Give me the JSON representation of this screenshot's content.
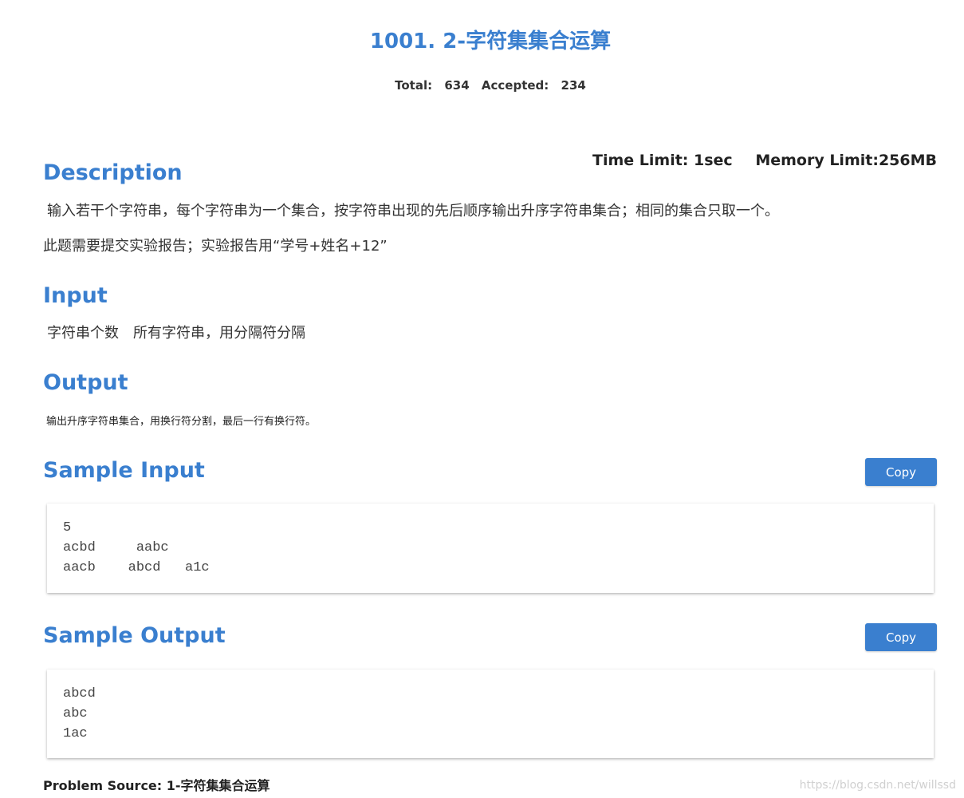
{
  "problem": {
    "title": "1001. 2-字符集集合运算",
    "total_label": "Total:",
    "total_value": "634",
    "accepted_label": "Accepted:",
    "accepted_value": "234",
    "time_limit": "Time Limit: 1sec",
    "memory_limit": "Memory Limit:256MB"
  },
  "description": {
    "heading": "Description",
    "line1": "输入若干个字符串，每个字符串为一个集合，按字符串出现的先后顺序输出升序字符串集合；相同的集合只取一个。",
    "line2": "此题需要提交实验报告；实验报告用“学号+姓名+12”"
  },
  "input": {
    "heading": "Input",
    "text": "字符串个数　所有字符串，用分隔符分隔"
  },
  "output": {
    "heading": "Output",
    "text": "输出升序字符串集合，用换行符分割，最后一行有换行符。"
  },
  "sample_input": {
    "heading": "Sample Input",
    "copy_label": "Copy",
    "code": "5\nacbd     aabc\naacb    abcd   a1c"
  },
  "sample_output": {
    "heading": "Sample Output",
    "copy_label": "Copy",
    "code": "abcd\nabc\n1ac"
  },
  "footer": {
    "source_label": "Problem Source: 1-字符集集合运算",
    "watermark": "https://blog.csdn.net/willssd"
  },
  "colors": {
    "accent": "#3a7fcf",
    "text": "#333333",
    "watermark": "#d0d0d0"
  }
}
